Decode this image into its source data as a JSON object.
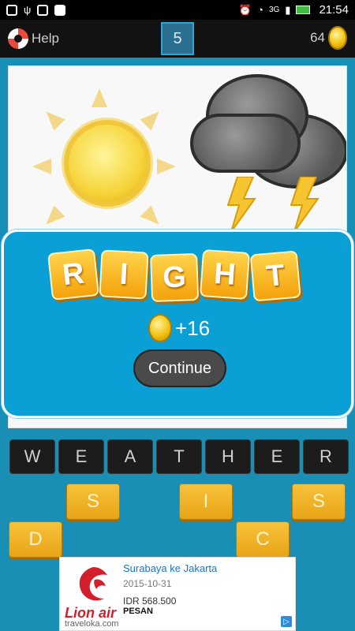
{
  "status_bar": {
    "time": "21:54",
    "network": "3G"
  },
  "topbar": {
    "help_label": "Help",
    "level": "5",
    "coins": "64"
  },
  "result": {
    "word_letters": [
      "R",
      "I",
      "G",
      "H",
      "T"
    ],
    "reward": "+16",
    "continue_label": "Continue"
  },
  "answer_slots": [
    "W",
    "E",
    "A",
    "T",
    "H",
    "E",
    "R"
  ],
  "letter_keys": [
    "S",
    "I",
    "S",
    "D",
    "C"
  ],
  "ad": {
    "title": "Surabaya ke Jakarta",
    "date": "2015-10-31",
    "price": "IDR 568.500",
    "cta": "PESAN",
    "brand": "Lion air",
    "domain": "traveloka.com"
  },
  "icons": [
    "lifebuoy-icon",
    "coin-icon",
    "sun-icon",
    "storm-cloud-icon",
    "lion-logo"
  ]
}
